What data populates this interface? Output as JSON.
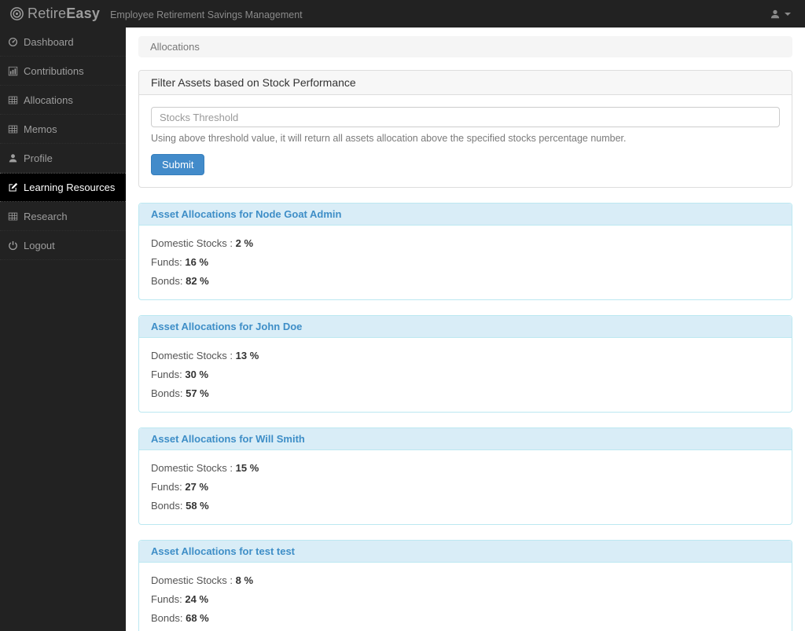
{
  "navbar": {
    "brand_first": "Retire",
    "brand_second": "Easy",
    "subtitle": "Employee Retirement Savings Management"
  },
  "sidebar": {
    "items": [
      {
        "label": "Dashboard",
        "icon": "dashboard-icon",
        "active": false
      },
      {
        "label": "Contributions",
        "icon": "bar-chart-icon",
        "active": false
      },
      {
        "label": "Allocations",
        "icon": "table-icon",
        "active": false
      },
      {
        "label": "Memos",
        "icon": "table-icon",
        "active": false
      },
      {
        "label": "Profile",
        "icon": "user-icon",
        "active": false
      },
      {
        "label": "Learning Resources",
        "icon": "edit-icon",
        "active": true
      },
      {
        "label": "Research",
        "icon": "table-icon",
        "active": false
      },
      {
        "label": "Logout",
        "icon": "power-icon",
        "active": false
      }
    ]
  },
  "breadcrumb": {
    "label": "Allocations"
  },
  "filter_panel": {
    "title": "Filter Assets based on Stock Performance",
    "input_placeholder": "Stocks Threshold",
    "input_value": "",
    "help_text": "Using above threshold value, it will return all assets allocation above the specified stocks percentage number.",
    "submit_label": "Submit"
  },
  "allocations": [
    {
      "title": "Asset Allocations for Node Goat Admin",
      "rows": [
        {
          "label": "Domestic Stocks :",
          "value": "2 %"
        },
        {
          "label": "Funds:",
          "value": "16 %"
        },
        {
          "label": "Bonds:",
          "value": "82 %"
        }
      ]
    },
    {
      "title": "Asset Allocations for John Doe",
      "rows": [
        {
          "label": "Domestic Stocks :",
          "value": "13 %"
        },
        {
          "label": "Funds:",
          "value": "30 %"
        },
        {
          "label": "Bonds:",
          "value": "57 %"
        }
      ]
    },
    {
      "title": "Asset Allocations for Will Smith",
      "rows": [
        {
          "label": "Domestic Stocks :",
          "value": "15 %"
        },
        {
          "label": "Funds:",
          "value": "27 %"
        },
        {
          "label": "Bonds:",
          "value": "58 %"
        }
      ]
    },
    {
      "title": "Asset Allocations for test test",
      "rows": [
        {
          "label": "Domestic Stocks :",
          "value": "8 %"
        },
        {
          "label": "Funds:",
          "value": "24 %"
        },
        {
          "label": "Bonds:",
          "value": "68 %"
        }
      ]
    }
  ],
  "colors": {
    "navbar_bg": "#222222",
    "sidebar_active_bg": "#000000",
    "accent_blue": "#428bca",
    "info_heading_bg": "#d9edf7",
    "info_border": "#bce8f1",
    "info_title": "#3e8ec7",
    "breadcrumb_bg": "#f5f5f5"
  }
}
